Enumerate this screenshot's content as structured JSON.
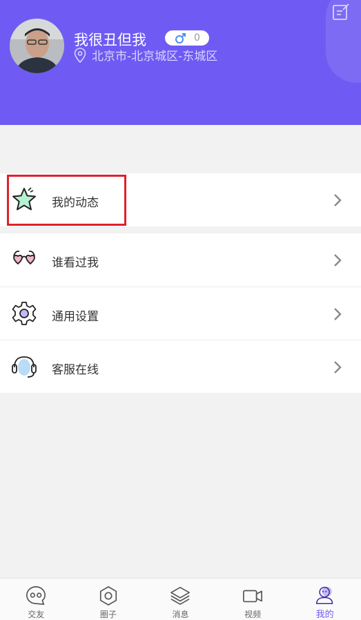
{
  "colors": {
    "accent": "#6f5bf3",
    "background": "#f2f2f2",
    "highlight": "#e0202a"
  },
  "profile": {
    "username": "我很丑但我",
    "gender_icon": "male-icon",
    "badge_count": "0",
    "location": "北京市-北京城区-东城区"
  },
  "menu": [
    {
      "label": "我的动态",
      "icon": "star-icon"
    },
    {
      "label": "谁看过我",
      "icon": "glasses-icon"
    },
    {
      "label": "通用设置",
      "icon": "gear-icon"
    },
    {
      "label": "客服在线",
      "icon": "headset-icon"
    }
  ],
  "tabs": [
    {
      "label": "交友",
      "icon": "chat-bubble-icon",
      "active": false
    },
    {
      "label": "圈子",
      "icon": "hexagon-icon",
      "active": false
    },
    {
      "label": "消息",
      "icon": "layers-icon",
      "active": false
    },
    {
      "label": "视频",
      "icon": "video-camera-icon",
      "active": false
    },
    {
      "label": "我的",
      "icon": "user-icon",
      "active": true
    }
  ]
}
